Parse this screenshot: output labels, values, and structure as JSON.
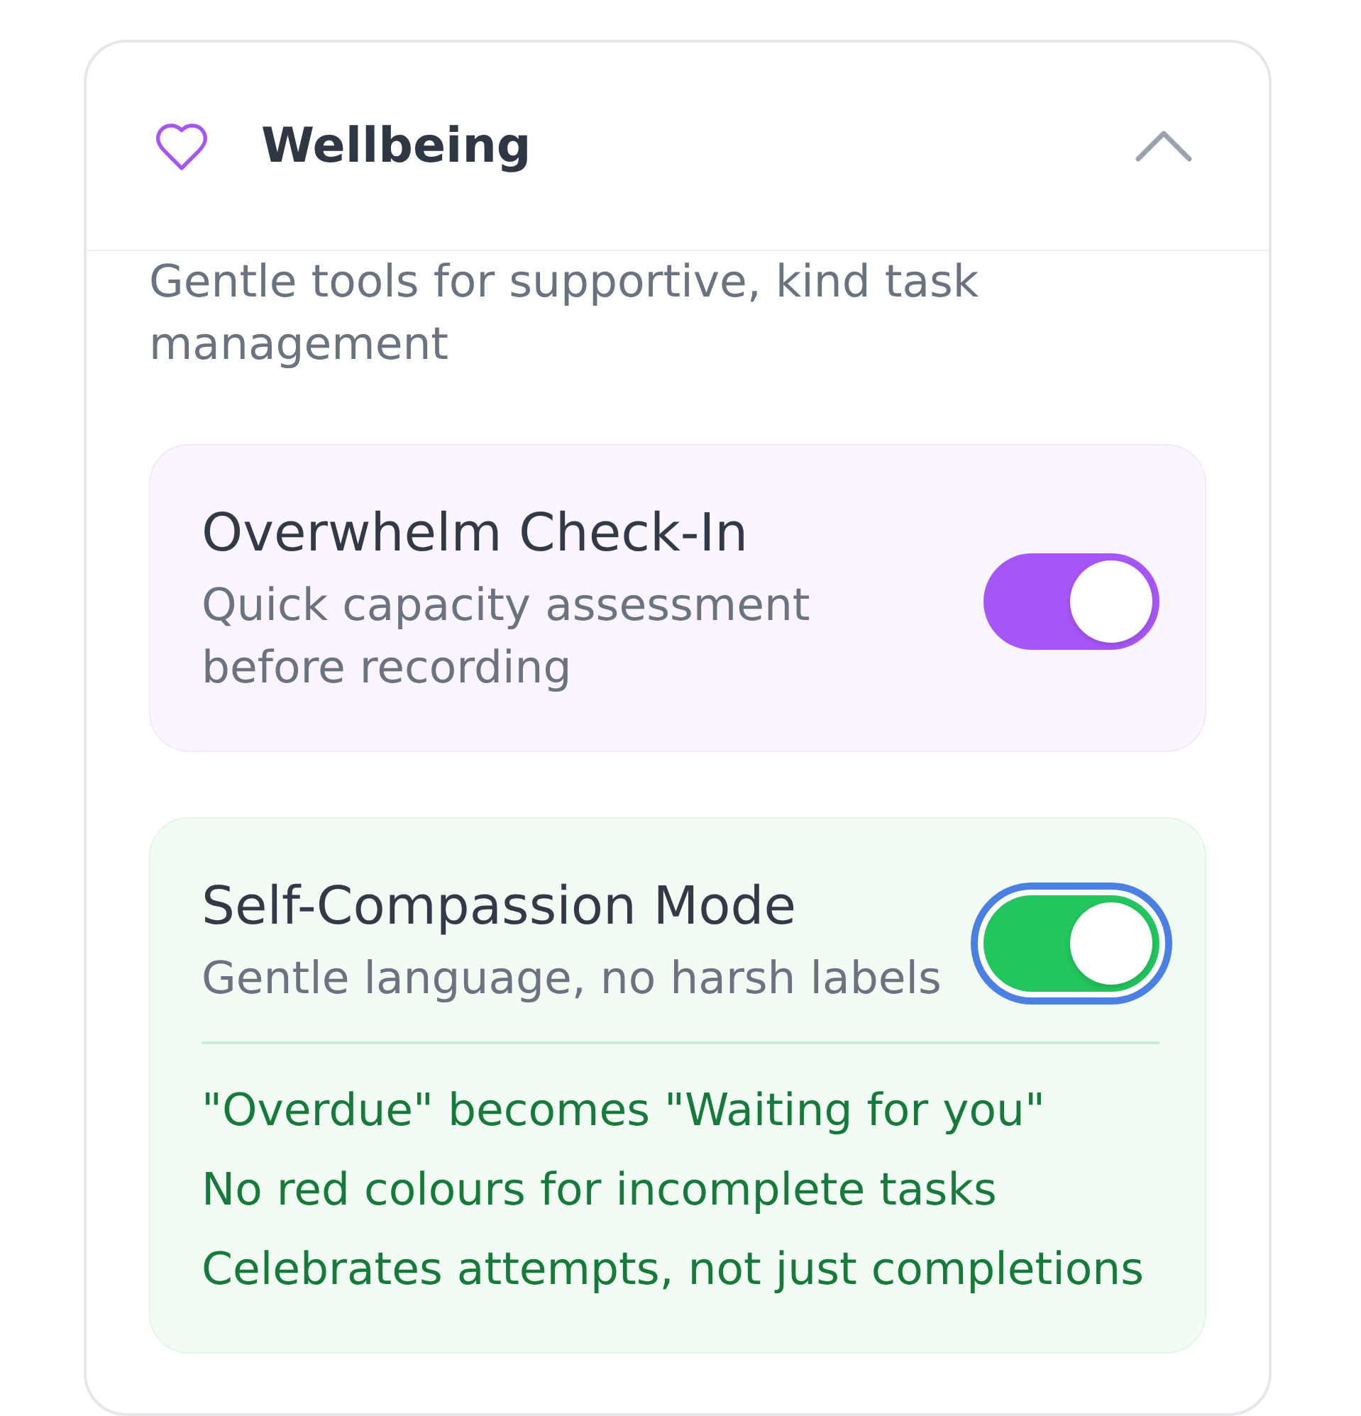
{
  "section": {
    "title": "Wellbeing",
    "expanded": true,
    "description": "Gentle tools for supportive, kind task management"
  },
  "settings": [
    {
      "title": "Overwhelm Check-In",
      "description": "Quick capacity assessment before recording",
      "on": true,
      "focused": false,
      "color": "#a855f7"
    },
    {
      "title": "Self-Compassion Mode",
      "description": "Gentle language, no harsh labels",
      "on": true,
      "focused": true,
      "color": "#22c55e",
      "notes": [
        "\"Overdue\" becomes \"Waiting for you\"",
        "No red colours for incomplete tasks",
        "Celebrates attempts, not just completions"
      ]
    }
  ]
}
